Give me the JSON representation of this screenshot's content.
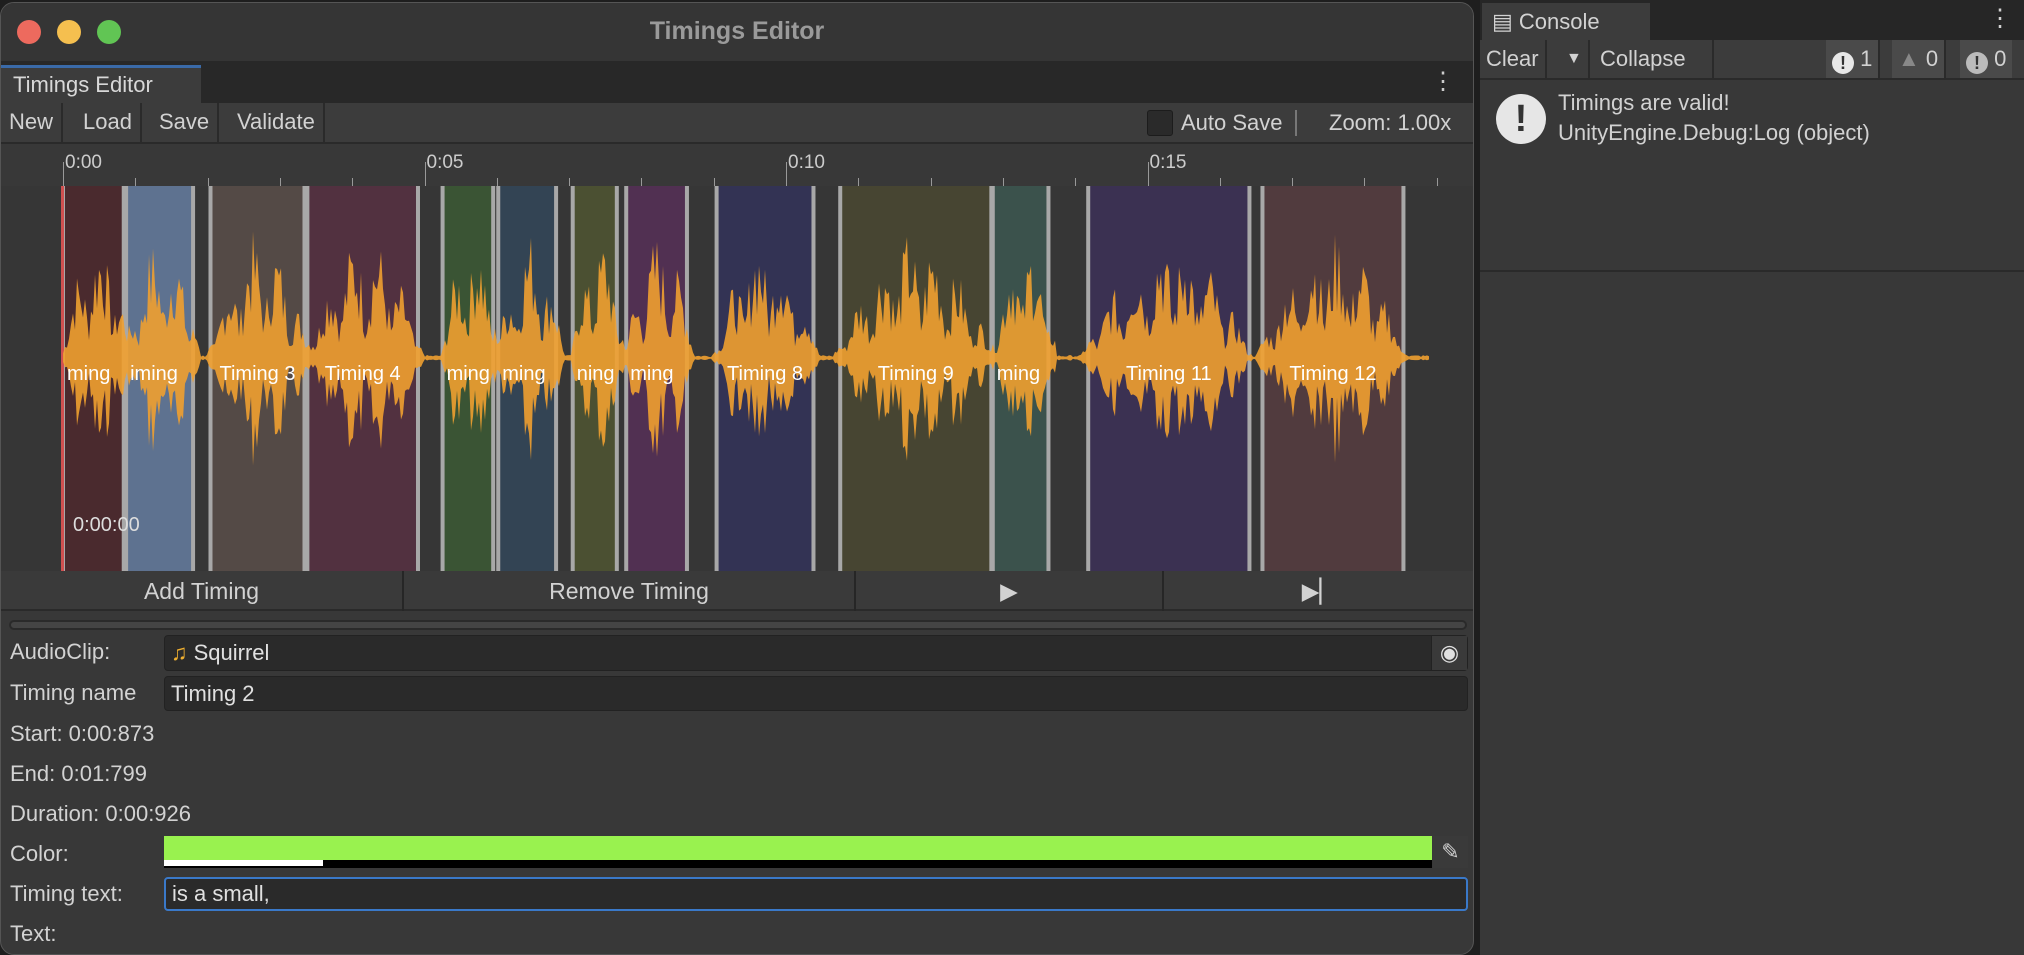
{
  "window": {
    "title": "Timings Editor",
    "tab": "Timings Editor"
  },
  "toolbar": {
    "new": "New",
    "load": "Load",
    "save": "Save",
    "validate": "Validate",
    "auto_save": "Auto Save",
    "auto_save_checked": false,
    "zoom": "Zoom: 1.00x"
  },
  "timeline": {
    "ticks": [
      "0:00",
      "0:05",
      "0:10",
      "0:15"
    ],
    "playhead_time": "0:00:00",
    "waveform_color": "#f0a030",
    "segments": [
      {
        "label": "ming",
        "start": 0,
        "end": 0.84,
        "color": "#4a2a2e"
      },
      {
        "label": "iming",
        "start": 0.873,
        "end": 1.799,
        "color": "#5e7290"
      },
      {
        "label": "Timing 3",
        "start": 2.04,
        "end": 3.34,
        "color": "#544a46"
      },
      {
        "label": "Timing 4",
        "start": 3.38,
        "end": 4.91,
        "color": "#523140"
      },
      {
        "label": "ming",
        "start": 5.25,
        "end": 5.95,
        "color": "#3a5434"
      },
      {
        "label": "ming",
        "start": 6.02,
        "end": 6.82,
        "color": "#334454"
      },
      {
        "label": "ning",
        "start": 7.05,
        "end": 7.66,
        "color": "#4b5032"
      },
      {
        "label": "ming",
        "start": 7.79,
        "end": 8.63,
        "color": "#513052"
      },
      {
        "label": "Timing 8",
        "start": 9.04,
        "end": 10.38,
        "color": "#333354"
      },
      {
        "label": "Timing 9",
        "start": 10.75,
        "end": 12.84,
        "color": "#474532"
      },
      {
        "label": "ming",
        "start": 12.86,
        "end": 13.63,
        "color": "#3b524c"
      },
      {
        "label": "Timing 11",
        "start": 14.18,
        "end": 16.41,
        "color": "#3b3152"
      },
      {
        "label": "Timing 12",
        "start": 16.59,
        "end": 18.54,
        "color": "#513b3e"
      }
    ]
  },
  "buttons": {
    "add": "Add Timing",
    "remove": "Remove Timing",
    "play_icon": "play-icon",
    "skip_icon": "skip-next-icon"
  },
  "inspector": {
    "audioclip_label": "AudioClip:",
    "audioclip_value": "Squirrel",
    "name_label": "Timing name",
    "name_value": "Timing 2",
    "start": "Start: 0:00:873",
    "end": "End: 0:01:799",
    "duration": "Duration: 0:00:926",
    "color_label": "Color:",
    "color_value": "#99f24f",
    "color_alpha": 0.125,
    "text_label": "Timing text:",
    "text_value": "is a small,",
    "text2_label": "Text:"
  },
  "console": {
    "tab": "Console",
    "clear": "Clear",
    "collapse": "Collapse",
    "info_count": "1",
    "warn_count": "0",
    "error_count": "0",
    "messages": [
      {
        "line1": "Timings are valid!",
        "line2": "UnityEngine.Debug:Log (object)"
      }
    ]
  }
}
